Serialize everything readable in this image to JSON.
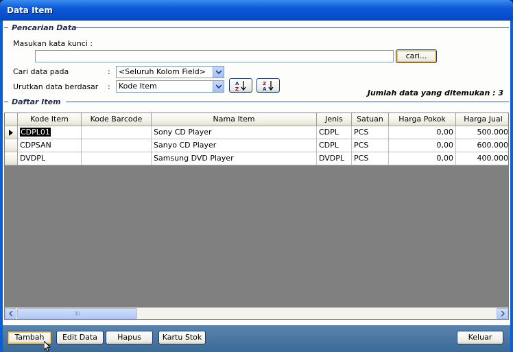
{
  "window": {
    "title": "Data Item"
  },
  "search_group": {
    "label": "Pencarian Data",
    "keyword_label": "Masukan kata kunci :",
    "keyword_value": "",
    "search_button": "cari...",
    "field_label": "Cari data pada",
    "field_colon": ":",
    "field_value": "<Seluruh Kolom Field>",
    "sort_label": "Urutkan data berdasar",
    "sort_colon": ":",
    "sort_value": "Kode Item",
    "sort_asc_icon": "sort-ascending-icon",
    "sort_desc_icon": "sort-descending-icon",
    "sort_asc_top": "A",
    "sort_asc_bottom": "Z",
    "sort_desc_top": "Z",
    "sort_desc_bottom": "A"
  },
  "count_text": "Jumlah data yang ditemukan : 3",
  "list_group": {
    "label": "Daftar Item"
  },
  "grid": {
    "columns": [
      "Kode Item",
      "Kode Barcode",
      "Nama Item",
      "Jenis",
      "Satuan",
      "Harga Pokok",
      "Harga Jual"
    ],
    "rows": [
      [
        "CDPL01",
        "",
        "Sony CD Player",
        "CDPL",
        "PCS",
        "0,00",
        "500.000"
      ],
      [
        "CDPSAN",
        "",
        "Sanyo CD Player",
        "CDPL",
        "PCS",
        "0,00",
        "600.000"
      ],
      [
        "DVDPL",
        "",
        "Samsung DVD Player",
        "DVDPL",
        "PCS",
        "0,00",
        "400.000"
      ]
    ]
  },
  "footer": {
    "add": "Tambah",
    "edit": "Edit Data",
    "delete": "Hapus",
    "stock_card": "Kartu Stok",
    "exit": "Keluar"
  },
  "colors": {
    "title_bar": "#0547c4",
    "footer": "#3b6a98",
    "grid_empty": "#808080"
  }
}
